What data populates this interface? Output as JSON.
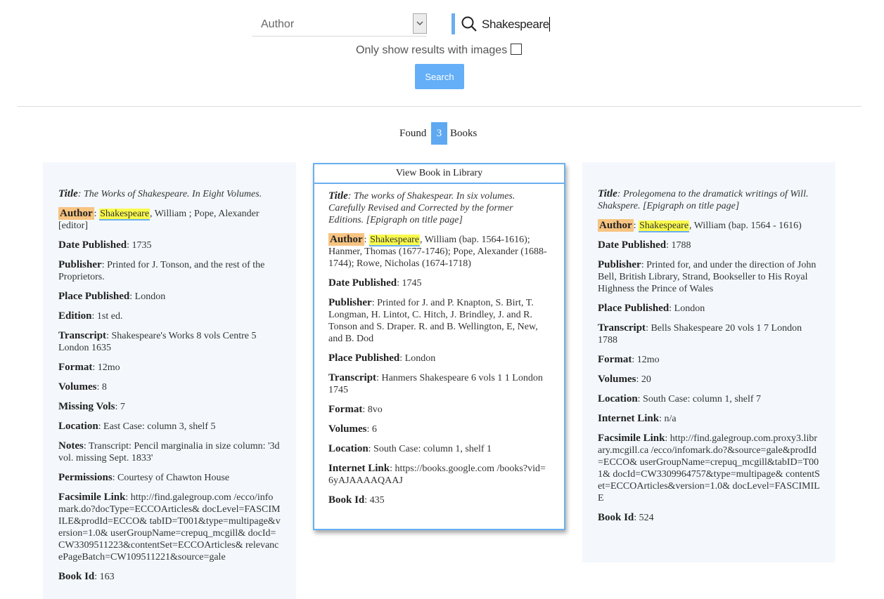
{
  "search": {
    "field_selected": "Author",
    "query": "Shakespeare",
    "images_only_label": "Only show results with images",
    "images_only_checked": false,
    "button_label": "Search"
  },
  "results": {
    "found_prefix": "Found",
    "count": "3",
    "found_suffix": "Books",
    "view_button_label": "View Book in Library"
  },
  "colors": {
    "accent": "#5ea9f2",
    "author_highlight": "#f7c481",
    "name_highlight": "#fafa4d",
    "card_bg": "#f4f8fc"
  },
  "books": [
    {
      "title_label": "Title",
      "title": ": The Works of Shakespeare. In Eight Volumes.",
      "author_label": "Author",
      "author_sep": ": ",
      "author_name": "Shakespeare",
      "author_rest": ", William ; Pope, Alexander [editor]",
      "fields": [
        {
          "label": "Date Published",
          "value": ": 1735"
        },
        {
          "label": "Publisher",
          "value": ": Printed for J. Tonson, and the rest of the Proprietors."
        },
        {
          "label": "Place Published",
          "value": ": London"
        },
        {
          "label": "Edition",
          "value": ": 1st ed."
        },
        {
          "label": "Transcript",
          "value": ": Shakespeare's Works 8 vols Centre 5 London 1635"
        },
        {
          "label": "Format",
          "value": ": 12mo"
        },
        {
          "label": "Volumes",
          "value": ": 8"
        },
        {
          "label": "Missing Vols",
          "value": ": 7"
        },
        {
          "label": "Location",
          "value": ": East Case: column 3, shelf 5"
        },
        {
          "label": "Notes",
          "value": ": Transcript: Pencil marginalia in size column: '3d vol. missing Sept. 1833'"
        },
        {
          "label": "Permissions",
          "value": ": Courtesy of Chawton House"
        },
        {
          "label": "Facsimile Link",
          "value": ": http://find.galegroup.com /ecco/infomark.do?docType=ECCOArticles& docLevel=FASCIMILE&prodId=ECCO& tabID=T001&type=multipage&version=1.0& userGroupName=crepuq_mcgill& docId=CW3309511223&contentSet=ECCOArticles& relevancePageBatch=CW109511221&source=gale"
        },
        {
          "label": "Book Id",
          "value": ": 163"
        }
      ]
    },
    {
      "title_label": "Title",
      "title": ": The works of Shakespear. In six volumes. Carefully Revised and Corrected by the former Editions. [Epigraph on title page]",
      "author_label": "Author",
      "author_sep": ": ",
      "author_name": "Shakespeare",
      "author_rest": ", William (bap. 1564-1616); Hanmer, Thomas (1677-1746); Pope, Alexander (1688-1744); Rowe, Nicholas (1674-1718)",
      "fields": [
        {
          "label": "Date Published",
          "value": ": 1745"
        },
        {
          "label": "Publisher",
          "value": ": Printed for J. and P. Knapton, S. Birt, T. Longman, H. Lintot, C. Hitch, J. Brindley, J. and R. Tonson and S. Draper. R. and B. Wellington, E, New, and B. Dod"
        },
        {
          "label": "Place Published",
          "value": ": London"
        },
        {
          "label": "Transcript",
          "value": ": Hanmers Shakespeare 6 vols 1 1 London 1745"
        },
        {
          "label": "Format",
          "value": ": 8vo"
        },
        {
          "label": "Volumes",
          "value": ": 6"
        },
        {
          "label": "Location",
          "value": ": South Case: column 1, shelf 1"
        },
        {
          "label": "Internet Link",
          "value": ": https://books.google.com /books?vid=6yAJAAAAQAAJ"
        },
        {
          "label": "Book Id",
          "value": ": 435"
        }
      ]
    },
    {
      "title_label": "Title",
      "title": ": Prolegomena to the dramatick writings of Will. Shakspere. [Epigraph on title page]",
      "author_label": "Author",
      "author_sep": ": ",
      "author_name": "Shakespeare",
      "author_rest": ", William (bap. 1564 - 1616)",
      "fields": [
        {
          "label": "Date Published",
          "value": ": 1788"
        },
        {
          "label": "Publisher",
          "value": ": Printed for, and under the direction of John Bell, British Library, Strand, Bookseller to His Royal Highness the Prince of Wales"
        },
        {
          "label": "Place Published",
          "value": ": London"
        },
        {
          "label": "Transcript",
          "value": ": Bells Shakespeare 20 vols 1 7 London 1788"
        },
        {
          "label": "Format",
          "value": ": 12mo"
        },
        {
          "label": "Volumes",
          "value": ": 20"
        },
        {
          "label": "Location",
          "value": ": South Case: column 1, shelf 7"
        },
        {
          "label": "Internet Link",
          "value": ": n/a"
        },
        {
          "label": "Facsimile Link",
          "value": ": http://find.galegroup.com.proxy3.library.mcgill.ca /ecco/infomark.do?&source=gale&prodId=ECCO& userGroupName=crepuq_mcgill&tabID=T001& docId=CW3309964757&type=multipage& contentSet=ECCOArticles&version=1.0& docLevel=FASCIMILE"
        },
        {
          "label": "Book Id",
          "value": ": 524"
        }
      ]
    }
  ]
}
